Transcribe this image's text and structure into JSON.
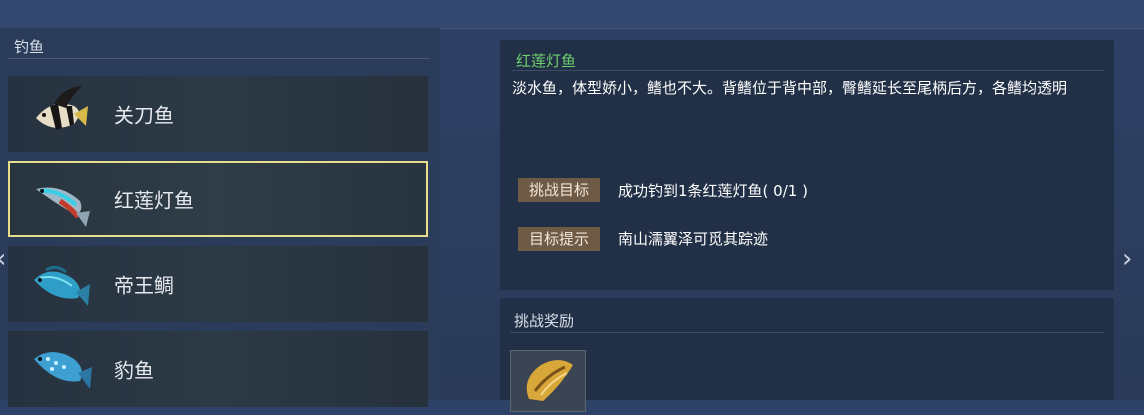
{
  "panel": {
    "title": "钓鱼"
  },
  "fish_list": [
    {
      "name": "关刀鱼",
      "icon": "moorish-idol-fish-icon",
      "selected": false
    },
    {
      "name": "红莲灯鱼",
      "icon": "neon-tetra-fish-icon",
      "selected": true
    },
    {
      "name": "帝王鲷",
      "icon": "blue-fish-icon",
      "selected": false
    },
    {
      "name": "豹鱼",
      "icon": "spotted-blue-fish-icon",
      "selected": false
    }
  ],
  "detail": {
    "title": "红莲灯鱼",
    "description": "淡水鱼，体型娇小，鳍也不大。背鳍位于背中部，臀鳍延长至尾柄后方，各鳍均透明",
    "challenge_label": "挑战目标",
    "challenge_text": "成功钓到1条红莲灯鱼( 0/1 )",
    "hint_label": "目标提示",
    "hint_text": "南山濡翼泽可觅其踪迹"
  },
  "reward": {
    "title": "挑战奖励",
    "item_icon": "golden-shell-icon"
  },
  "nav": {
    "prev": "‹",
    "next": "›"
  },
  "colors": {
    "selected_border": "#e8dd8a",
    "detail_title": "#6fcf6f",
    "tag_bg": "#6e5a45"
  }
}
